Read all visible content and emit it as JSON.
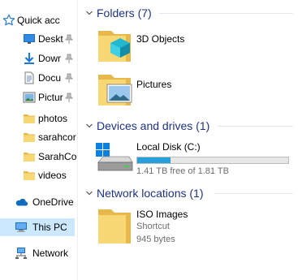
{
  "nav": {
    "items": [
      {
        "label": "Quick acc",
        "icon": "star-icon",
        "pinned": false
      },
      {
        "label": "Deskt",
        "icon": "desktop-icon",
        "pinned": true
      },
      {
        "label": "Dowr",
        "icon": "download-icon",
        "pinned": true
      },
      {
        "label": "Docu",
        "icon": "document-icon",
        "pinned": true
      },
      {
        "label": "Pictur",
        "icon": "pictures-icon",
        "pinned": true
      },
      {
        "label": "photos",
        "icon": "folder-icon",
        "pinned": false
      },
      {
        "label": "sarahcor",
        "icon": "folder-icon",
        "pinned": false
      },
      {
        "label": "SarahCo",
        "icon": "folder-icon",
        "pinned": false
      },
      {
        "label": "videos",
        "icon": "folder-icon",
        "pinned": false
      },
      {
        "label": "OneDrive",
        "icon": "onedrive-icon",
        "pinned": false
      },
      {
        "label": "This PC",
        "icon": "computer-icon",
        "pinned": false,
        "selected": true
      },
      {
        "label": "Network",
        "icon": "network-icon",
        "pinned": false
      }
    ]
  },
  "groups": {
    "folders": {
      "title": "Folders (7)"
    },
    "devices": {
      "title": "Devices and drives (1)"
    },
    "network": {
      "title": "Network locations (1)"
    }
  },
  "folders": [
    {
      "name": "3D Objects",
      "icon": "3d-objects-folder-icon"
    },
    {
      "name": "Pictures",
      "icon": "pictures-folder-icon"
    }
  ],
  "drive": {
    "name": "Local Disk (C:)",
    "free_text": "1.41 TB free of 1.81 TB",
    "used_fraction": 0.221,
    "icon": "windows-drive-icon"
  },
  "network_location": {
    "name": "ISO Images",
    "type": "Shortcut",
    "size": "945 bytes",
    "icon": "folder-shortcut-icon"
  },
  "colors": {
    "group_header": "#1e3287",
    "selection": "#cce8ff",
    "bar_fill": "#26a0da",
    "folder": "#f8d775"
  }
}
